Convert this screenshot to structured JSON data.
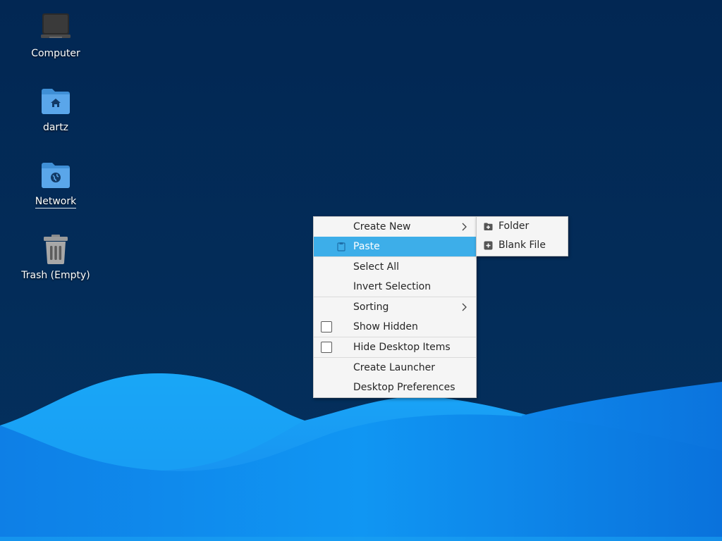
{
  "desktop": {
    "icons": [
      {
        "label": "Computer",
        "icon": "computer-icon"
      },
      {
        "label": "dartz",
        "icon": "home-folder-icon"
      },
      {
        "label": "Network",
        "icon": "network-folder-icon"
      },
      {
        "label": "Trash (Empty)",
        "icon": "trash-icon"
      }
    ]
  },
  "context_menu": {
    "items": [
      {
        "label": "Create New",
        "submenu": true
      },
      {
        "label": "Paste",
        "icon": "clipboard-icon",
        "highlighted": true
      },
      {
        "label": "Select All"
      },
      {
        "label": "Invert Selection"
      },
      {
        "label": "Sorting",
        "submenu": true
      },
      {
        "label": "Show Hidden",
        "checkbox": false
      },
      {
        "label": "Hide Desktop Items",
        "checkbox": false
      },
      {
        "label": "Create Launcher"
      },
      {
        "label": "Desktop Preferences"
      }
    ]
  },
  "create_new_submenu": {
    "items": [
      {
        "label": "Folder",
        "icon": "folder-add-icon"
      },
      {
        "label": "Blank File",
        "icon": "file-add-icon"
      }
    ]
  },
  "colors": {
    "desktop_background": "#04284f",
    "wave_light": "#19a4f6",
    "wave_dark": "#0a6fd8",
    "menu_highlight": "#3daee9"
  }
}
